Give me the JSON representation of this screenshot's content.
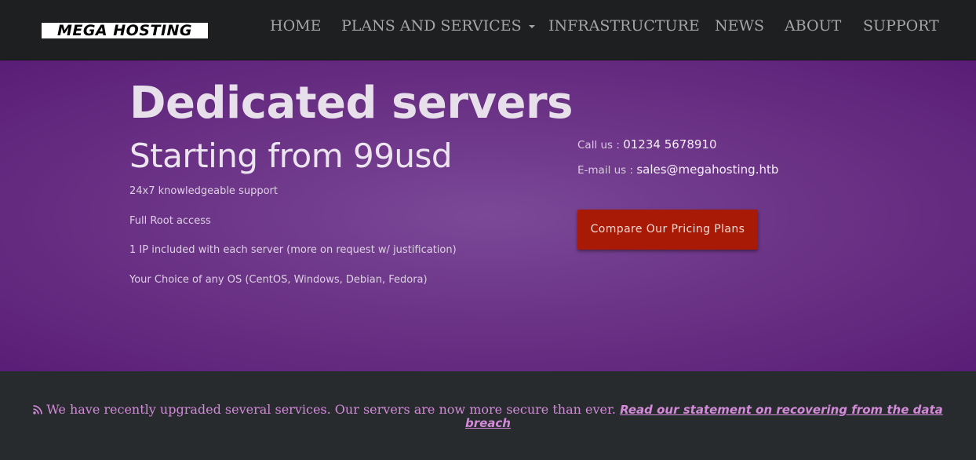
{
  "brand": {
    "logo_text": "MEGA HOSTING"
  },
  "nav": {
    "home": "HOME",
    "plans": "PLANS AND SERVICES",
    "infrastructure": "INFRASTRUCTURE",
    "news": "NEWS",
    "about": "ABOUT",
    "support": "SUPPORT"
  },
  "hero": {
    "title": "Dedicated servers",
    "subtitle": "Starting from 99usd",
    "features": [
      "24x7 knowledgeable support",
      "Full Root access",
      "1 IP included with each server (more on request w/ justification)",
      "Your Choice of any OS (CentOS, Windows, Debian, Fedora)"
    ],
    "contact": {
      "call_label": "Call us : ",
      "phone": "01234 5678910",
      "email_label": "E-mail us : ",
      "email": "sales@megahosting.htb"
    },
    "cta_label": "Compare Our Pricing Plans"
  },
  "notice": {
    "text": "We have recently upgraded several services. Our servers are now more secure than ever.",
    "link_text_line1": "Read our statement on recovering from the data",
    "link_text_line2": "breach",
    "icon": "rss-icon"
  },
  "colors": {
    "navbar_bg": "#1d1f20",
    "hero_purple": "#6c3487",
    "cta_red": "#a81a06",
    "notice_text": "#d38ad9",
    "footer_bg": "#272b2e"
  }
}
